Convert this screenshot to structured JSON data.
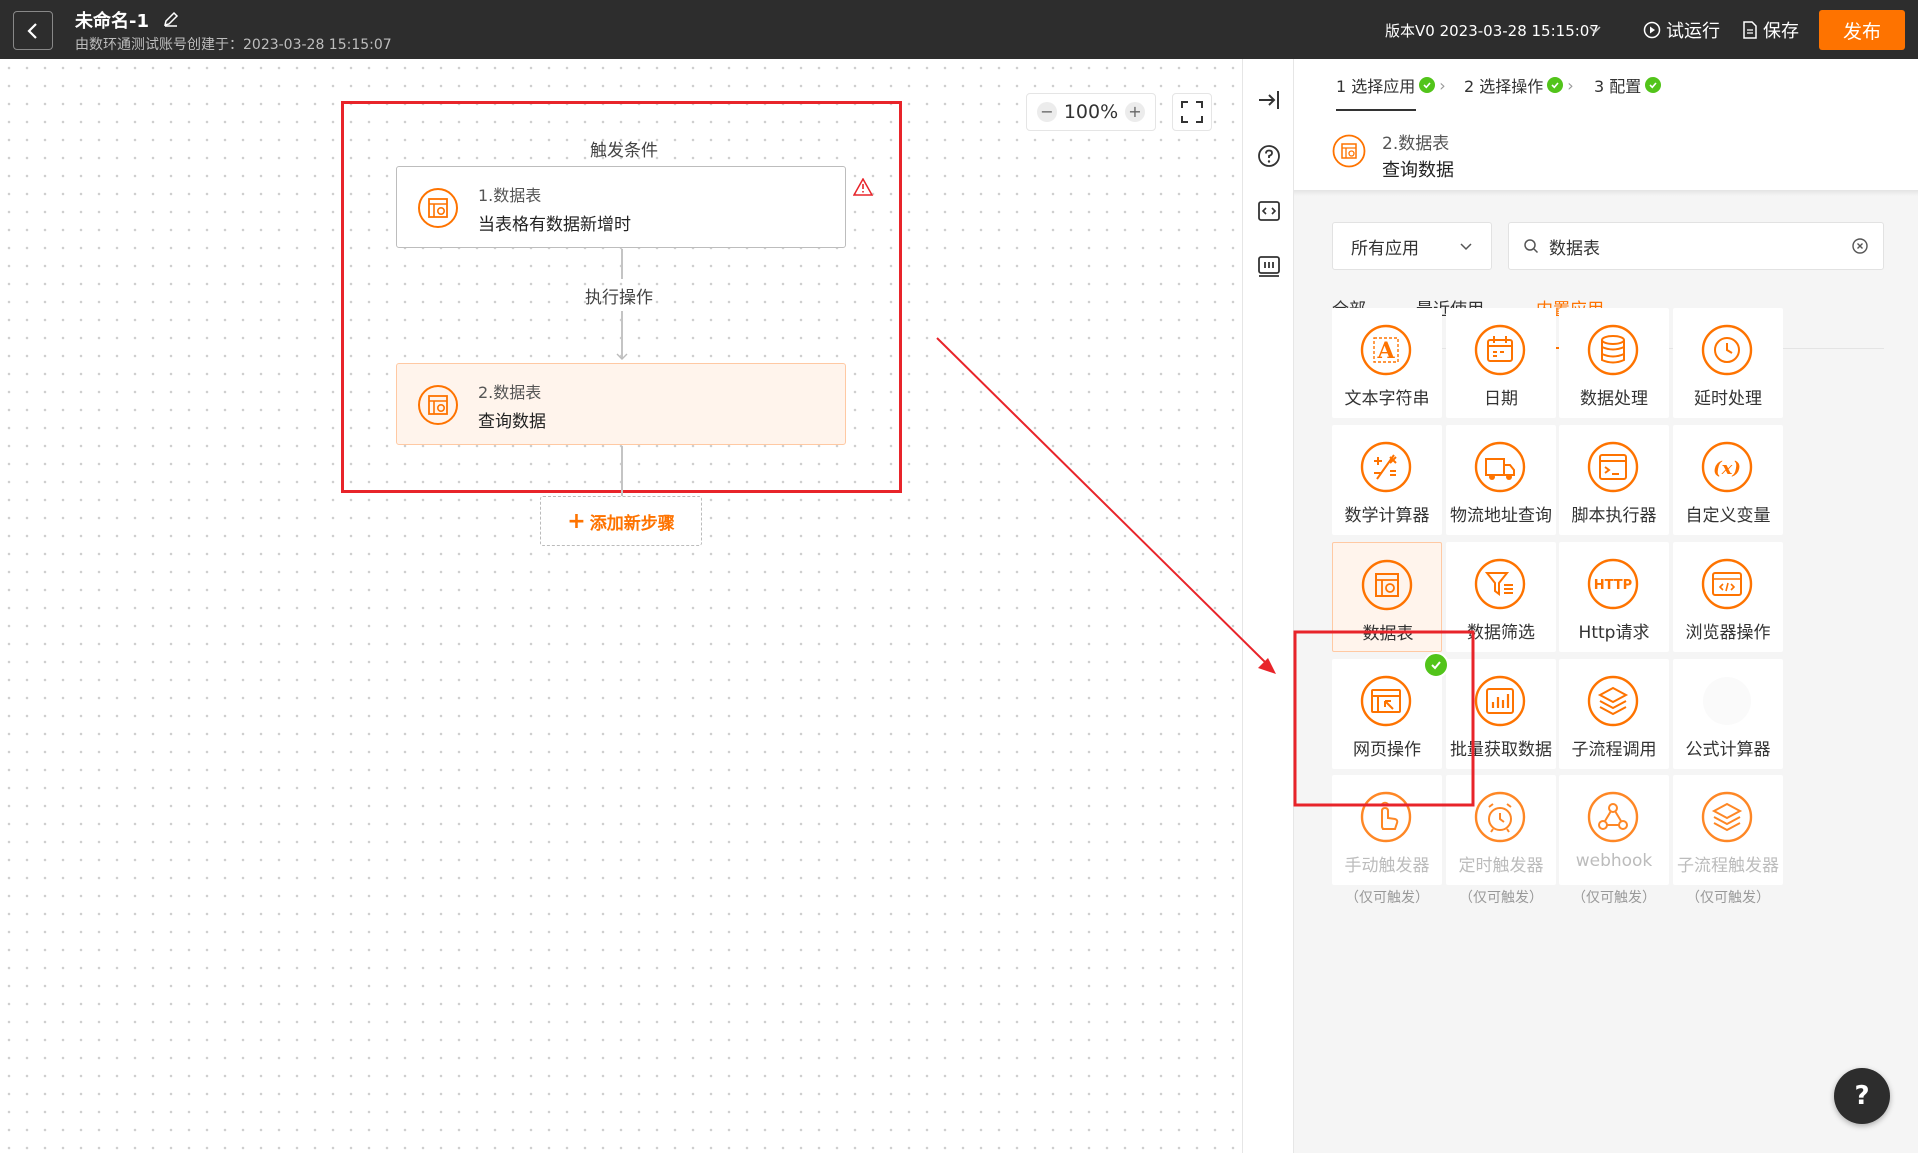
{
  "header": {
    "title": "未命名-1",
    "subtitle": "由数环通测试账号创建于：2023-03-28 15:15:07",
    "version": "版本V0 2023-03-28 15:15:07",
    "try_run": "试运行",
    "save": "保存",
    "publish": "发布"
  },
  "canvas": {
    "zoom": "100%",
    "trigger_label": "触发条件",
    "action_label": "执行操作",
    "nodes": [
      {
        "name": "1.数据表",
        "desc": "当表格有数据新增时"
      },
      {
        "name": "2.数据表",
        "desc": "查询数据"
      }
    ],
    "add_step": "添加新步骤"
  },
  "panel": {
    "steps": [
      {
        "label": "1 选择应用"
      },
      {
        "label": "2 选择操作"
      },
      {
        "label": "3 配置"
      }
    ],
    "selected": {
      "name": "2.数据表",
      "desc": "查询数据"
    },
    "filter": {
      "value": "所有应用"
    },
    "search": {
      "value": "数据表"
    },
    "tabs": [
      {
        "label": "全部"
      },
      {
        "label": "最近使用"
      },
      {
        "label": "内置应用"
      }
    ],
    "apps": [
      {
        "label": "文本字符串",
        "icon": "text-icon"
      },
      {
        "label": "日期",
        "icon": "calendar-icon"
      },
      {
        "label": "数据处理",
        "icon": "database-icon"
      },
      {
        "label": "延时处理",
        "icon": "clock-icon"
      },
      {
        "label": "数学计算器",
        "icon": "math-icon"
      },
      {
        "label": "物流地址查询",
        "icon": "truck-icon"
      },
      {
        "label": "脚本执行器",
        "icon": "script-icon"
      },
      {
        "label": "自定义变量",
        "icon": "variable-icon"
      },
      {
        "label": "数据表",
        "icon": "table-icon"
      },
      {
        "label": "数据筛选",
        "icon": "filter-icon"
      },
      {
        "label": "Http请求",
        "icon": "http-icon"
      },
      {
        "label": "浏览器操作",
        "icon": "browser-icon"
      },
      {
        "label": "网页操作",
        "icon": "webpage-icon"
      },
      {
        "label": "批量获取数据",
        "icon": "chart-icon"
      },
      {
        "label": "子流程调用",
        "icon": "layers-icon"
      },
      {
        "label": "公式计算器",
        "icon": "formula-icon"
      },
      {
        "label": "手动触发器",
        "icon": "hand-icon",
        "note": "（仅可触发）"
      },
      {
        "label": "定时触发器",
        "icon": "alarm-icon",
        "note": "（仅可触发）"
      },
      {
        "label": "webhook",
        "icon": "webhook-icon",
        "note": "（仅可触发）"
      },
      {
        "label": "子流程触发器",
        "icon": "layers-icon",
        "note": "（仅可触发）"
      }
    ]
  },
  "colors": {
    "accent": "#fe7300",
    "success": "#52c41a",
    "annotation": "#e8242a"
  }
}
